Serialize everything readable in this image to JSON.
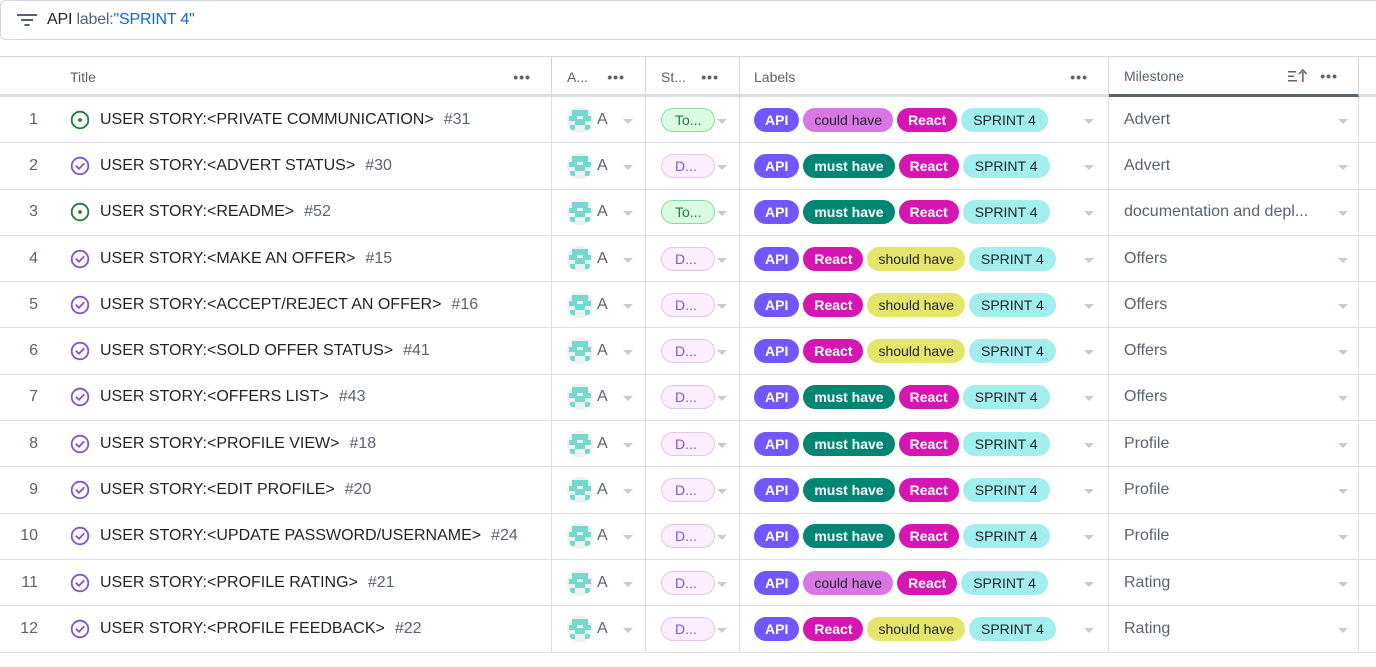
{
  "filter": {
    "keyword": "API",
    "qualifier": "label:",
    "value": "\"SPRINT 4\""
  },
  "columns": {
    "title": "Title",
    "assignees": "A...",
    "status": "St...",
    "labels": "Labels",
    "milestone": "Milestone"
  },
  "colors": {
    "open_state": "#1a7f37",
    "closed_state": "#8250df",
    "label_api": "#7057ff",
    "label_could_have": "#d876e3",
    "label_must_have": "#008672",
    "label_react": "#d516b3",
    "label_should_have": "#e4e669",
    "label_sprint": "#a2eeef"
  },
  "rows": [
    {
      "num": "1",
      "state": "open",
      "title": "USER STORY:<PRIVATE COMMUNICATION>",
      "issue": "#31",
      "assignee": "A",
      "status": "To...",
      "status_kind": "todo",
      "labels": [
        {
          "text": "API",
          "kind": "api"
        },
        {
          "text": "could have",
          "kind": "could"
        },
        {
          "text": "React",
          "kind": "react"
        },
        {
          "text": "SPRINT 4",
          "kind": "sprint"
        }
      ],
      "milestone": "Advert"
    },
    {
      "num": "2",
      "state": "closed",
      "title": "USER STORY:<ADVERT STATUS>",
      "issue": "#30",
      "assignee": "A",
      "status": "D...",
      "status_kind": "done",
      "labels": [
        {
          "text": "API",
          "kind": "api"
        },
        {
          "text": "must have",
          "kind": "must"
        },
        {
          "text": "React",
          "kind": "react"
        },
        {
          "text": "SPRINT 4",
          "kind": "sprint"
        }
      ],
      "milestone": "Advert"
    },
    {
      "num": "3",
      "state": "open",
      "title": "USER STORY:<README>",
      "issue": "#52",
      "assignee": "A",
      "status": "To...",
      "status_kind": "todo",
      "labels": [
        {
          "text": "API",
          "kind": "api"
        },
        {
          "text": "must have",
          "kind": "must"
        },
        {
          "text": "React",
          "kind": "react"
        },
        {
          "text": "SPRINT 4",
          "kind": "sprint"
        }
      ],
      "milestone": "documentation and depl..."
    },
    {
      "num": "4",
      "state": "closed",
      "title": "USER STORY:<MAKE AN OFFER>",
      "issue": "#15",
      "assignee": "A",
      "status": "D...",
      "status_kind": "done",
      "labels": [
        {
          "text": "API",
          "kind": "api"
        },
        {
          "text": "React",
          "kind": "react"
        },
        {
          "text": "should have",
          "kind": "should"
        },
        {
          "text": "SPRINT 4",
          "kind": "sprint"
        }
      ],
      "milestone": "Offers"
    },
    {
      "num": "5",
      "state": "closed",
      "title": "USER STORY:<ACCEPT/REJECT AN OFFER>",
      "issue": "#16",
      "assignee": "A",
      "status": "D...",
      "status_kind": "done",
      "labels": [
        {
          "text": "API",
          "kind": "api"
        },
        {
          "text": "React",
          "kind": "react"
        },
        {
          "text": "should have",
          "kind": "should"
        },
        {
          "text": "SPRINT 4",
          "kind": "sprint"
        }
      ],
      "milestone": "Offers"
    },
    {
      "num": "6",
      "state": "closed",
      "title": "USER STORY:<SOLD OFFER STATUS>",
      "issue": "#41",
      "assignee": "A",
      "status": "D...",
      "status_kind": "done",
      "labels": [
        {
          "text": "API",
          "kind": "api"
        },
        {
          "text": "React",
          "kind": "react"
        },
        {
          "text": "should have",
          "kind": "should"
        },
        {
          "text": "SPRINT 4",
          "kind": "sprint"
        }
      ],
      "milestone": "Offers"
    },
    {
      "num": "7",
      "state": "closed",
      "title": "USER STORY:<OFFERS LIST>",
      "issue": "#43",
      "assignee": "A",
      "status": "D...",
      "status_kind": "done",
      "labels": [
        {
          "text": "API",
          "kind": "api"
        },
        {
          "text": "must have",
          "kind": "must"
        },
        {
          "text": "React",
          "kind": "react"
        },
        {
          "text": "SPRINT 4",
          "kind": "sprint"
        }
      ],
      "milestone": "Offers"
    },
    {
      "num": "8",
      "state": "closed",
      "title": "USER STORY:<PROFILE VIEW>",
      "issue": "#18",
      "assignee": "A",
      "status": "D...",
      "status_kind": "done",
      "labels": [
        {
          "text": "API",
          "kind": "api"
        },
        {
          "text": "must have",
          "kind": "must"
        },
        {
          "text": "React",
          "kind": "react"
        },
        {
          "text": "SPRINT 4",
          "kind": "sprint"
        }
      ],
      "milestone": "Profile"
    },
    {
      "num": "9",
      "state": "closed",
      "title": "USER STORY:<EDIT PROFILE>",
      "issue": "#20",
      "assignee": "A",
      "status": "D...",
      "status_kind": "done",
      "labels": [
        {
          "text": "API",
          "kind": "api"
        },
        {
          "text": "must have",
          "kind": "must"
        },
        {
          "text": "React",
          "kind": "react"
        },
        {
          "text": "SPRINT 4",
          "kind": "sprint"
        }
      ],
      "milestone": "Profile"
    },
    {
      "num": "10",
      "state": "closed",
      "title": "USER STORY:<UPDATE PASSWORD/USERNAME>",
      "issue": "#24",
      "assignee": "A",
      "status": "D...",
      "status_kind": "done",
      "labels": [
        {
          "text": "API",
          "kind": "api"
        },
        {
          "text": "must have",
          "kind": "must"
        },
        {
          "text": "React",
          "kind": "react"
        },
        {
          "text": "SPRINT 4",
          "kind": "sprint"
        }
      ],
      "milestone": "Profile"
    },
    {
      "num": "11",
      "state": "closed",
      "title": "USER STORY:<PROFILE RATING>",
      "issue": "#21",
      "assignee": "A",
      "status": "D...",
      "status_kind": "done",
      "labels": [
        {
          "text": "API",
          "kind": "api"
        },
        {
          "text": "could have",
          "kind": "could"
        },
        {
          "text": "React",
          "kind": "react"
        },
        {
          "text": "SPRINT 4",
          "kind": "sprint"
        }
      ],
      "milestone": "Rating"
    },
    {
      "num": "12",
      "state": "closed",
      "title": "USER STORY:<PROFILE FEEDBACK>",
      "issue": "#22",
      "assignee": "A",
      "status": "D...",
      "status_kind": "done",
      "labels": [
        {
          "text": "API",
          "kind": "api"
        },
        {
          "text": "React",
          "kind": "react"
        },
        {
          "text": "should have",
          "kind": "should"
        },
        {
          "text": "SPRINT 4",
          "kind": "sprint"
        }
      ],
      "milestone": "Rating"
    }
  ]
}
